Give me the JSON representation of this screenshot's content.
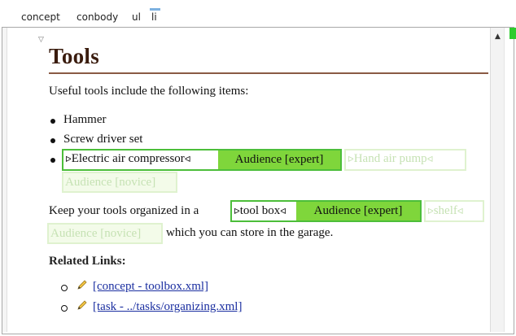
{
  "breadcrumb": {
    "items": [
      "concept",
      "conbody",
      "ul",
      "li"
    ]
  },
  "topic": {
    "title": "Tools",
    "intro": "Useful tools include the following items:",
    "list_items": {
      "hammer": "Hammer",
      "screwdriver": "Screw driver set",
      "compressor": "Electric air compressor",
      "air_pump": "Hand air pump"
    },
    "audience_expert": "Audience [expert]",
    "audience_novice": "Audience [novice]",
    "para2_prefix": "Keep your tools organized in a",
    "tool_box": "tool box",
    "shelf": "shelf",
    "para2_suffix": "which you can store in the garage.",
    "related_links_heading": "Related Links:",
    "links": [
      "[concept - toolbox.xml]",
      "[task - ../tasks/organizing.xml]"
    ]
  },
  "colors": {
    "title": "#3a1c0e",
    "active_border": "#4cbe3a",
    "audience_tag": "#7fd63b",
    "faded_text": "#c6e2b4",
    "link": "#1a2ea0"
  },
  "icons": {
    "collapse": "collapse-triangle-icon",
    "link": "pencil-link-icon",
    "scroll_up": "scroll-up-arrow-icon",
    "element_start": "element-start-marker-icon",
    "element_end": "element-end-marker-icon"
  }
}
